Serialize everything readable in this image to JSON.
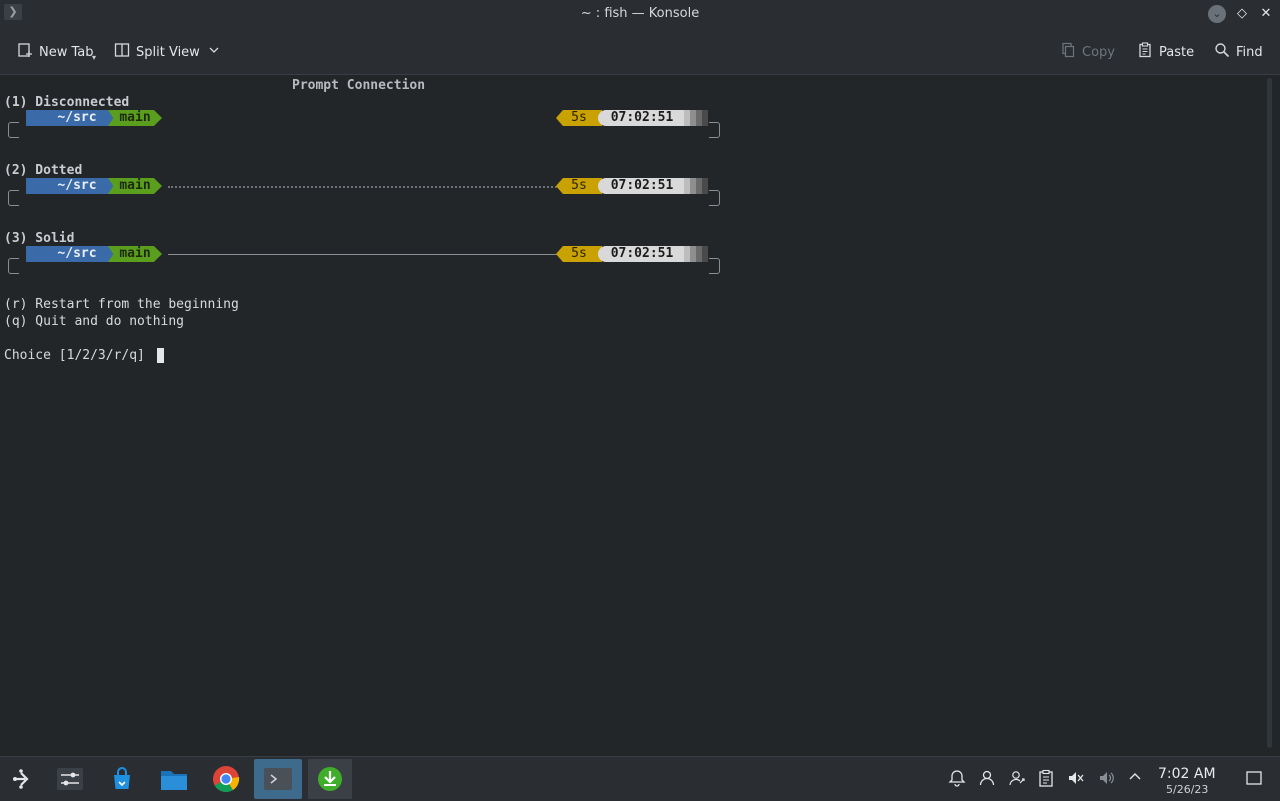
{
  "window": {
    "title": "~ : fish — Konsole"
  },
  "toolbar": {
    "new_tab": "New Tab",
    "split_view": "Split View",
    "copy": "Copy",
    "paste": "Paste",
    "find": "Find"
  },
  "terminal": {
    "heading": "Prompt Connection",
    "options": [
      {
        "label": "(1) Disconnected",
        "dir": "~/src",
        "branch": "main",
        "duration": "5s",
        "time": "07:02:51",
        "connection": "none"
      },
      {
        "label": "(2) Dotted",
        "dir": "~/src",
        "branch": "main",
        "duration": "5s",
        "time": "07:02:51",
        "connection": "dotted"
      },
      {
        "label": "(3) Solid",
        "dir": "~/src",
        "branch": "main",
        "duration": "5s",
        "time": "07:02:51",
        "connection": "solid"
      }
    ],
    "restart": "(r) Restart from the beginning",
    "quit": "(q) Quit and do nothing",
    "prompt": "Choice [1/2/3/r/q]"
  },
  "taskbar": {
    "apps": [
      "app-launcher-icon",
      "system-settings-icon",
      "discover-store-icon",
      "file-manager-icon",
      "chrome-icon",
      "konsole-icon",
      "downloader-icon"
    ],
    "active_app": "konsole-icon",
    "tray": [
      "notifications-icon",
      "user-icon",
      "user-switch-icon",
      "clipboard-icon",
      "volume-muted-icon",
      "mic-muted-icon",
      "tray-expand-icon"
    ],
    "clock_time": "7:02 AM",
    "clock_date": "5/26/23"
  },
  "colors": {
    "background": "#232629",
    "segment_dir": "#3a6aa8",
    "segment_branch": "#5b9e1d",
    "segment_duration": "#c9a100",
    "segment_clock": "#d9d9d9",
    "taskbar_active": "#3e6b8c"
  }
}
